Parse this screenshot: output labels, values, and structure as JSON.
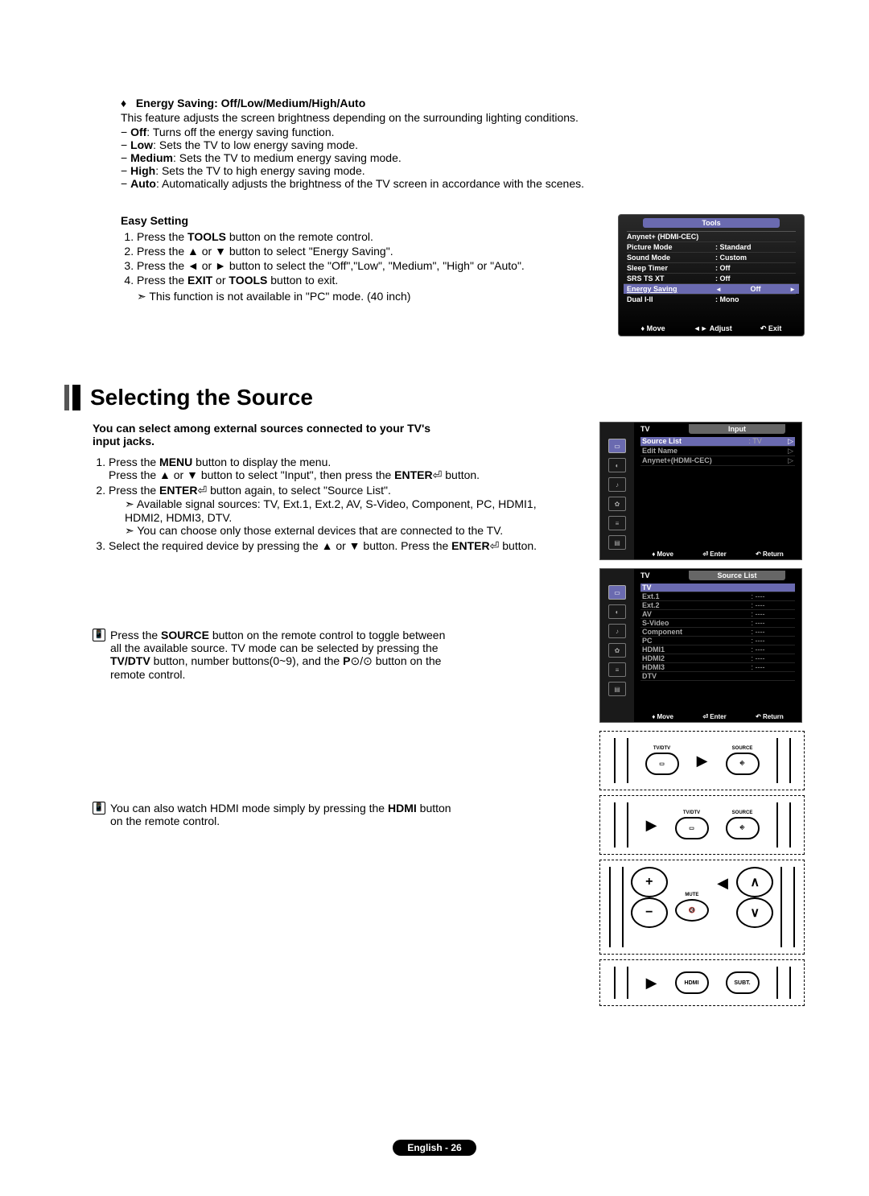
{
  "energy": {
    "heading": "Energy Saving:  Off/Low/Medium/High/Auto",
    "body": "This feature adjusts the screen brightness depending on the surrounding lighting conditions.",
    "opts": {
      "off": {
        "name": "Off",
        "desc": ": Turns off the energy saving function."
      },
      "low": {
        "name": "Low",
        "desc": ": Sets the TV to low energy saving mode."
      },
      "med": {
        "name": "Medium",
        "desc": ": Sets the TV to medium energy saving mode."
      },
      "high": {
        "name": "High",
        "desc": ": Sets the TV to high energy saving mode."
      },
      "auto": {
        "name": "Auto",
        "desc": ": Automatically adjusts the brightness of the TV screen in accordance with the scenes."
      }
    }
  },
  "easy": {
    "heading": "Easy Setting",
    "s1a": "Press the ",
    "s1b": "TOOLS",
    "s1c": " button on the remote control.",
    "s2": "Press the ▲ or ▼ button to select \"Energy Saving\".",
    "s3": "Press the ◄ or ► button to select the \"Off\",\"Low\", \"Medium\", \"High\" or \"Auto\".",
    "s4a": "Press the ",
    "s4b": "EXIT",
    "s4c": " or ",
    "s4d": "TOOLS",
    "s4e": " button to exit.",
    "note": "This function is not available in \"PC\" mode. (40 inch)"
  },
  "tools": {
    "title": "Tools",
    "rows": {
      "anynet": {
        "label": "Anynet+ (HDMI-CEC)",
        "val": ""
      },
      "picture": {
        "label": "Picture Mode",
        "val": ": Standard"
      },
      "sound": {
        "label": "Sound Mode",
        "val": ": Custom"
      },
      "sleep": {
        "label": "Sleep Timer",
        "val": ": Off"
      },
      "srs": {
        "label": "SRS TS XT",
        "val": ": Off"
      },
      "energy": {
        "label": "Energy Saving",
        "val": "Off"
      },
      "dual": {
        "label": "Dual I-II",
        "val": ": Mono"
      }
    },
    "footer": {
      "move": "Move",
      "adjust": "Adjust",
      "exit": "Exit"
    }
  },
  "section": {
    "heading": "Selecting the Source"
  },
  "intro": "You can select among external sources connected to your TV's input jacks.",
  "steps": {
    "s1": {
      "a": "Press the ",
      "b": "MENU",
      "c": " button to display the menu.",
      "d": "Press the ▲ or ▼ button to select \"Input\", then press the ",
      "e": "ENTER",
      "f": " button."
    },
    "s2": {
      "a": "Press the ",
      "b": "ENTER",
      "c": " button again, to select \"Source List\".",
      "n1": "Available signal sources:  TV, Ext.1, Ext.2, AV, S-Video, Component, PC, HDMI1, HDMI2, HDMI3, DTV.",
      "n2": "You can choose only those external devices that are connected to the TV."
    },
    "s3": {
      "a": "Select the required device by pressing the ▲ or ▼ button. Press the ",
      "b": "ENTER",
      "c": " button."
    }
  },
  "m1": {
    "a": "Press the ",
    "b": "SOURCE",
    "c": " button on the remote control to toggle between all the available source.",
    "d": "TV mode can be selected by pressing the ",
    "e": "TV/DTV",
    "f": " button, number buttons(0~9), and the ",
    "g": "P",
    "h": " button on the remote control."
  },
  "m2": {
    "a": "You can also watch HDMI mode simply by pressing the ",
    "b": "HDMI",
    "c": " button on the remote control."
  },
  "input_osd": {
    "tv": "TV",
    "title": "Input",
    "rows": {
      "source": {
        "name": "Source List",
        "val": ": TV"
      },
      "edit": {
        "name": "Edit Name",
        "val": ""
      },
      "anynet": {
        "name": "Anynet+(HDMI-CEC)",
        "val": ""
      }
    },
    "footer": {
      "move": "Move",
      "enter": "Enter",
      "ret": "Return"
    }
  },
  "source_osd": {
    "tv": "TV",
    "title": "Source List",
    "rows": [
      {
        "name": "TV",
        "val": ""
      },
      {
        "name": "Ext.1",
        "val": ": ----"
      },
      {
        "name": "Ext.2",
        "val": ": ----"
      },
      {
        "name": "AV",
        "val": ": ----"
      },
      {
        "name": "S-Video",
        "val": ": ----"
      },
      {
        "name": "Component",
        "val": ": ----"
      },
      {
        "name": "PC",
        "val": ": ----"
      },
      {
        "name": "HDMI1",
        "val": ": ----"
      },
      {
        "name": "HDMI2",
        "val": ": ----"
      },
      {
        "name": "HDMI3",
        "val": ": ----"
      },
      {
        "name": "DTV",
        "val": ""
      }
    ],
    "footer": {
      "move": "Move",
      "enter": "Enter",
      "ret": "Return"
    }
  },
  "remote": {
    "tvdtv": "TV/DTV",
    "source": "SOURCE",
    "mute": "MUTE",
    "hdmi": "HDMI",
    "subt": "SUBT."
  },
  "footer": "English - 26"
}
